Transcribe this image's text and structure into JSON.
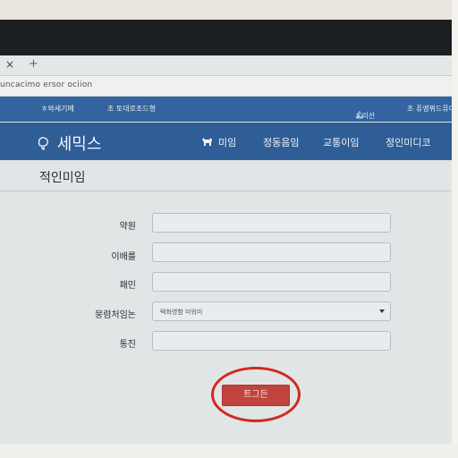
{
  "browser": {
    "tab_close": "×",
    "tab_new": "+",
    "url": "uncacimo ersor ociion"
  },
  "topstrip": {
    "left_link_1": "ㅎ와세기메",
    "left_link_2": "조 토대로조드형",
    "right_link_1": "ㅊ리선",
    "right_link_2": "조 퓨앵퓌드퓨다"
  },
  "navbar": {
    "logo": "세믹스",
    "items": [
      {
        "label": "미임",
        "icon": "animal-icon"
      },
      {
        "label": "정동음임"
      },
      {
        "label": "교통이임"
      },
      {
        "label": "정인미디코"
      }
    ]
  },
  "form": {
    "title": "적인미임",
    "fields": [
      {
        "label": "약원",
        "value": ""
      },
      {
        "label": "이배를",
        "value": ""
      },
      {
        "label": "패민",
        "value": ""
      },
      {
        "label": "뭉렴처임논",
        "value": "택화영함 미워미",
        "type": "select"
      },
      {
        "label": "통진",
        "value": ""
      }
    ],
    "submit_label": "트그든"
  },
  "colors": {
    "brand_blue": "#2f5d96",
    "submit_red": "#c0433e",
    "highlight_red": "#d12a1c"
  }
}
